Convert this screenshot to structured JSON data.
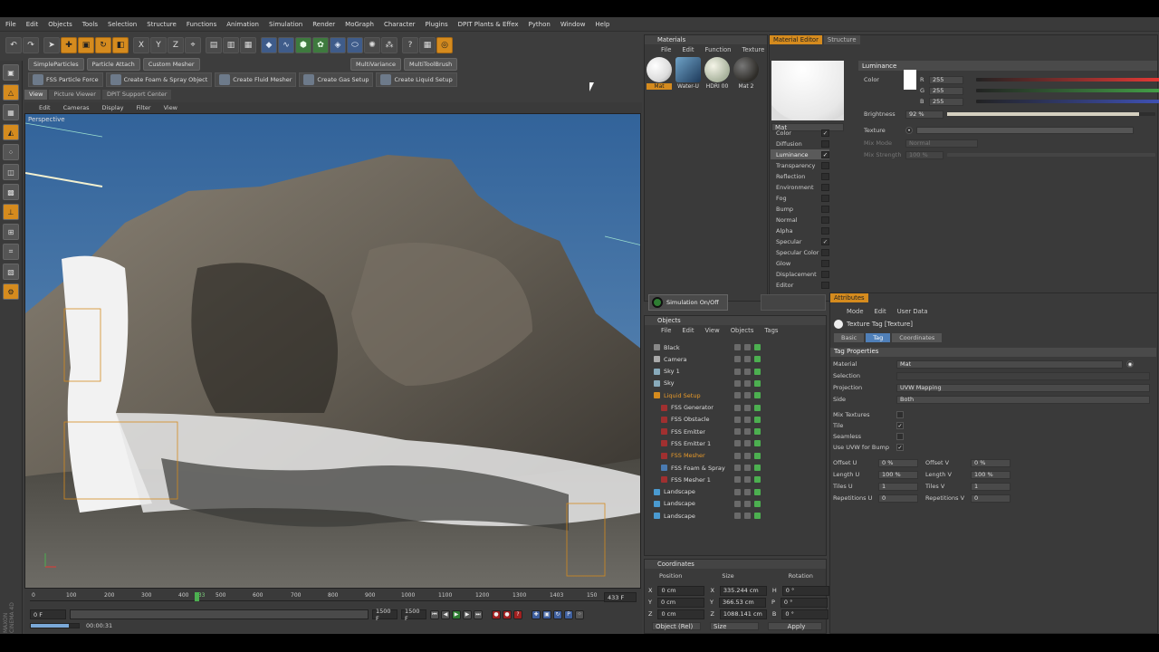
{
  "menubar": [
    "File",
    "Edit",
    "Objects",
    "Tools",
    "Selection",
    "Structure",
    "Functions",
    "Animation",
    "Simulation",
    "Render",
    "MoGraph",
    "Character",
    "Plugins",
    "DPIT Plants & Effex",
    "Python",
    "Window",
    "Help"
  ],
  "toolbar_pills": [
    "SimpleParticles",
    "Particle Attach",
    "Custom Mesher"
  ],
  "toolbar_pills2": [
    "MultiVariance",
    "MultiToolBrush"
  ],
  "fss_buttons": [
    "FSS Particle Force",
    "Create Foam & Spray Object",
    "Create Fluid Mesher",
    "Create Gas Setup",
    "Create Liquid Setup"
  ],
  "viewport": {
    "tabs": [
      "View",
      "Picture Viewer",
      "DPIT Support Center"
    ],
    "menu": [
      "Edit",
      "Cameras",
      "Display",
      "Filter",
      "View"
    ],
    "label": "Perspective"
  },
  "timeline": {
    "ticks": [
      "0",
      "100",
      "200",
      "300",
      "400",
      "433",
      "500",
      "600",
      "700",
      "800",
      "900",
      "1000",
      "1100",
      "1200",
      "1300",
      "1403",
      "150"
    ],
    "current_frame": "433 F",
    "start": "0 F",
    "min_field": "1500 F",
    "max_field": "1500 F",
    "time": "00:00:31"
  },
  "materials": {
    "title": "Materials",
    "menu": [
      "File",
      "Edit",
      "Function",
      "Texture"
    ],
    "items": [
      "Mat",
      "Water-U",
      "HDRI 00",
      "Mat 2"
    ]
  },
  "material_editor": {
    "tabs": [
      "Material Editor",
      "Structure"
    ],
    "name": "Mat",
    "channels": [
      {
        "label": "Color",
        "checked": true
      },
      {
        "label": "Diffusion",
        "checked": false
      },
      {
        "label": "Luminance",
        "checked": true,
        "active": true
      },
      {
        "label": "Transparency",
        "checked": false
      },
      {
        "label": "Reflection",
        "checked": false
      },
      {
        "label": "Environment",
        "checked": false
      },
      {
        "label": "Fog",
        "checked": false
      },
      {
        "label": "Bump",
        "checked": false
      },
      {
        "label": "Normal",
        "checked": false
      },
      {
        "label": "Alpha",
        "checked": false
      },
      {
        "label": "Specular",
        "checked": true
      },
      {
        "label": "Specular Color",
        "checked": false
      },
      {
        "label": "Glow",
        "checked": false
      },
      {
        "label": "Displacement",
        "checked": false
      },
      {
        "label": "Editor",
        "checked": false
      }
    ],
    "luminance": {
      "heading": "Luminance",
      "color_label": "Color",
      "r": "255",
      "g": "255",
      "b": "255",
      "brightness_label": "Brightness",
      "brightness": "92 %",
      "brightness_level": 0.92,
      "texture_label": "Texture",
      "mix_mode_label": "Mix Mode",
      "mix_mode": "Normal",
      "mix_strength_label": "Mix Strength",
      "mix_strength": "100 %"
    }
  },
  "simulation": {
    "label": "Simulation On/Off"
  },
  "objects": {
    "title": "Objects",
    "menu": [
      "File",
      "Edit",
      "View",
      "Objects",
      "Tags"
    ],
    "rows": [
      {
        "name": "Black",
        "color": "#888"
      },
      {
        "name": "Camera",
        "color": "#aaa"
      },
      {
        "name": "Sky 1",
        "color": "#8ab"
      },
      {
        "name": "Sky",
        "color": "#8ab"
      },
      {
        "name": "Liquid Setup",
        "color": "#d58b1e",
        "accent": true
      },
      {
        "name": "FSS Generator",
        "color": "#a03030"
      },
      {
        "name": "FSS Obstacle",
        "color": "#a03030"
      },
      {
        "name": "FSS Emitter",
        "color": "#a03030"
      },
      {
        "name": "FSS Emitter 1",
        "color": "#a03030"
      },
      {
        "name": "FSS Mesher",
        "color": "#a03030",
        "accent": true
      },
      {
        "name": "FSS Foam & Spray",
        "color": "#4a7ab0"
      },
      {
        "name": "FSS Mesher 1",
        "color": "#a03030"
      },
      {
        "name": "Landscape",
        "color": "#4a9ad0"
      },
      {
        "name": "Landscape",
        "color": "#4a9ad0"
      },
      {
        "name": "Landscape",
        "color": "#4a9ad0"
      }
    ]
  },
  "attributes": {
    "title": "Attributes",
    "menu": [
      "Mode",
      "Edit",
      "User Data"
    ],
    "tag_title": "Texture Tag [Texture]",
    "tabs": [
      "Basic",
      "Tag",
      "Coordinates"
    ],
    "section": "Tag Properties",
    "material_label": "Material",
    "material": "Mat",
    "selection_label": "Selection",
    "projection_label": "Projection",
    "projection": "UVW Mapping",
    "side_label": "Side",
    "side": "Both",
    "mix_textures_label": "Mix Textures",
    "tile_label": "Tile",
    "seamless_label": "Seamless",
    "use_uvw_label": "Use UVW for Bump",
    "offset_u_label": "Offset U",
    "offset_u": "0 %",
    "offset_v_label": "Offset V",
    "offset_v": "0 %",
    "length_u_label": "Length U",
    "length_u": "100 %",
    "length_v_label": "Length V",
    "length_v": "100 %",
    "tiles_u_label": "Tiles U",
    "tiles_u": "1",
    "tiles_v_label": "Tiles V",
    "tiles_v": "1",
    "rep_u_label": "Repetitions U",
    "rep_u": "0",
    "rep_v_label": "Repetitions V",
    "rep_v": "0"
  },
  "coordinates": {
    "title": "Coordinates",
    "headers": [
      "Position",
      "Size",
      "Rotation"
    ],
    "rows": [
      {
        "axis": "X",
        "pos": "0 cm",
        "size_axis": "X",
        "size": "335.244 cm",
        "rot_axis": "H",
        "rot": "0 °"
      },
      {
        "axis": "Y",
        "pos": "0 cm",
        "size_axis": "Y",
        "size": "366.53 cm",
        "rot_axis": "P",
        "rot": "0 °"
      },
      {
        "axis": "Z",
        "pos": "0 cm",
        "size_axis": "Z",
        "size": "1088.141 cm",
        "rot_axis": "B",
        "rot": "0 °"
      }
    ],
    "mode": "Object (Rel)",
    "size_mode": "Size",
    "apply": "Apply"
  },
  "branding": "MAXON CINEMA 4D",
  "colors": {
    "accent": "#d58b1e",
    "panel": "#3d3d3d",
    "sky": "#4c79a6"
  }
}
